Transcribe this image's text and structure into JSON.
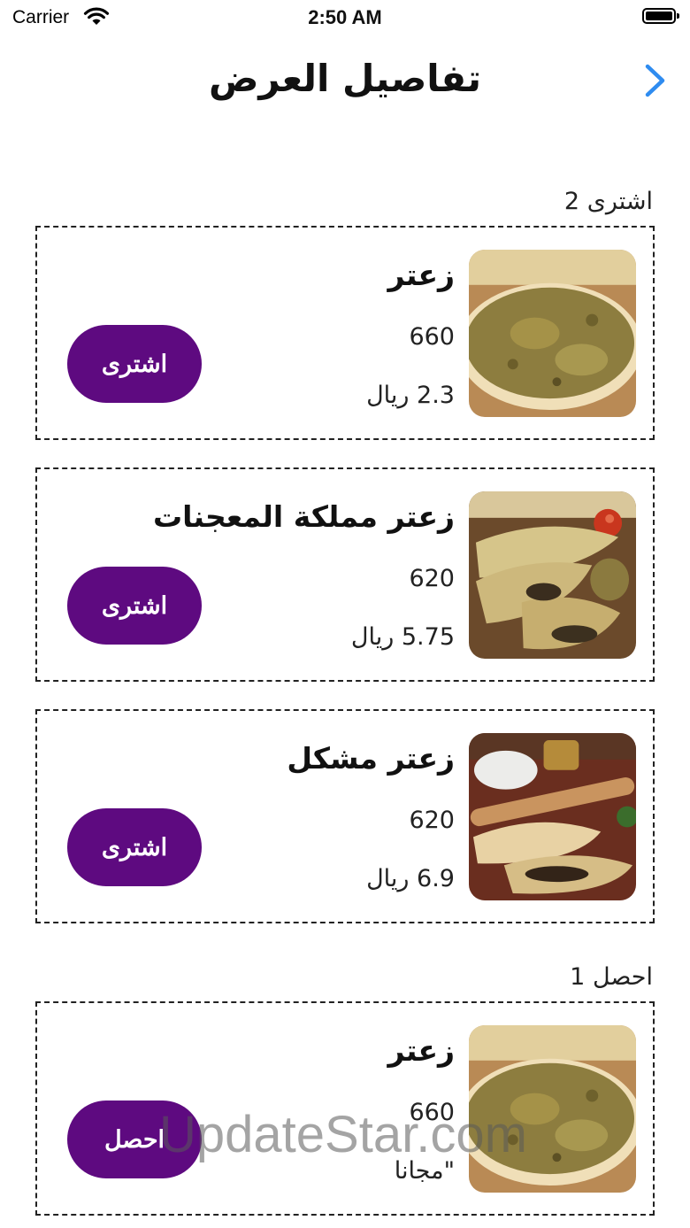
{
  "status_bar": {
    "carrier": "Carrier",
    "time": "2:50 AM"
  },
  "nav": {
    "title": "تفاصيل العرض",
    "back_icon": "chevron-right-icon"
  },
  "buy_section": {
    "label": "اشترى 2",
    "items": [
      {
        "name": "زعتر",
        "qty": "660",
        "price": "2.3 ريال",
        "button": "اشترى",
        "image": "zaatar-manakish"
      },
      {
        "name": "زعتر مملكة المعجنات",
        "qty": "620",
        "price": "5.75 ريال",
        "button": "اشترى",
        "image": "zaatar-fatayer"
      },
      {
        "name": "زعتر مشكل",
        "qty": "620",
        "price": "6.9 ريال",
        "button": "اشترى",
        "image": "zaatar-mixed"
      }
    ]
  },
  "get_section": {
    "label": "احصل 1",
    "items": [
      {
        "name": "زعتر",
        "qty": "660",
        "price": "\"مجانا",
        "button": "احصل",
        "image": "zaatar-manakish"
      }
    ]
  },
  "watermark": "UpdateStar.com",
  "colors": {
    "button": "#5e0a80",
    "back": "#2f8cf0"
  }
}
